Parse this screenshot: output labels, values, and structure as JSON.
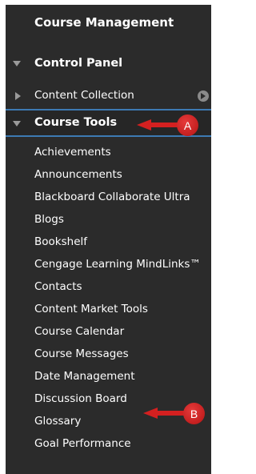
{
  "header": {
    "title": "Course Management"
  },
  "control_panel": {
    "label": "Control Panel"
  },
  "content_collection": {
    "label": "Content Collection"
  },
  "course_tools": {
    "label": "Course Tools",
    "items": [
      "Achievements",
      "Announcements",
      "Blackboard Collaborate Ultra",
      "Blogs",
      "Bookshelf",
      "Cengage Learning MindLinks™",
      "Contacts",
      "Content Market Tools",
      "Course Calendar",
      "Course Messages",
      "Date Management",
      "Discussion Board",
      "Glossary",
      "Goal Performance"
    ]
  },
  "annotations": {
    "a": "A",
    "b": "B"
  },
  "colors": {
    "panel_bg": "#2b2b2b",
    "highlight_border": "#3d7ab3",
    "marker_red": "#d42020"
  },
  "icons": {
    "control_panel": "caret-down-icon",
    "content_collection": "caret-right-icon",
    "content_collection_go": "circle-arrow-right-icon",
    "course_tools": "caret-down-icon"
  }
}
